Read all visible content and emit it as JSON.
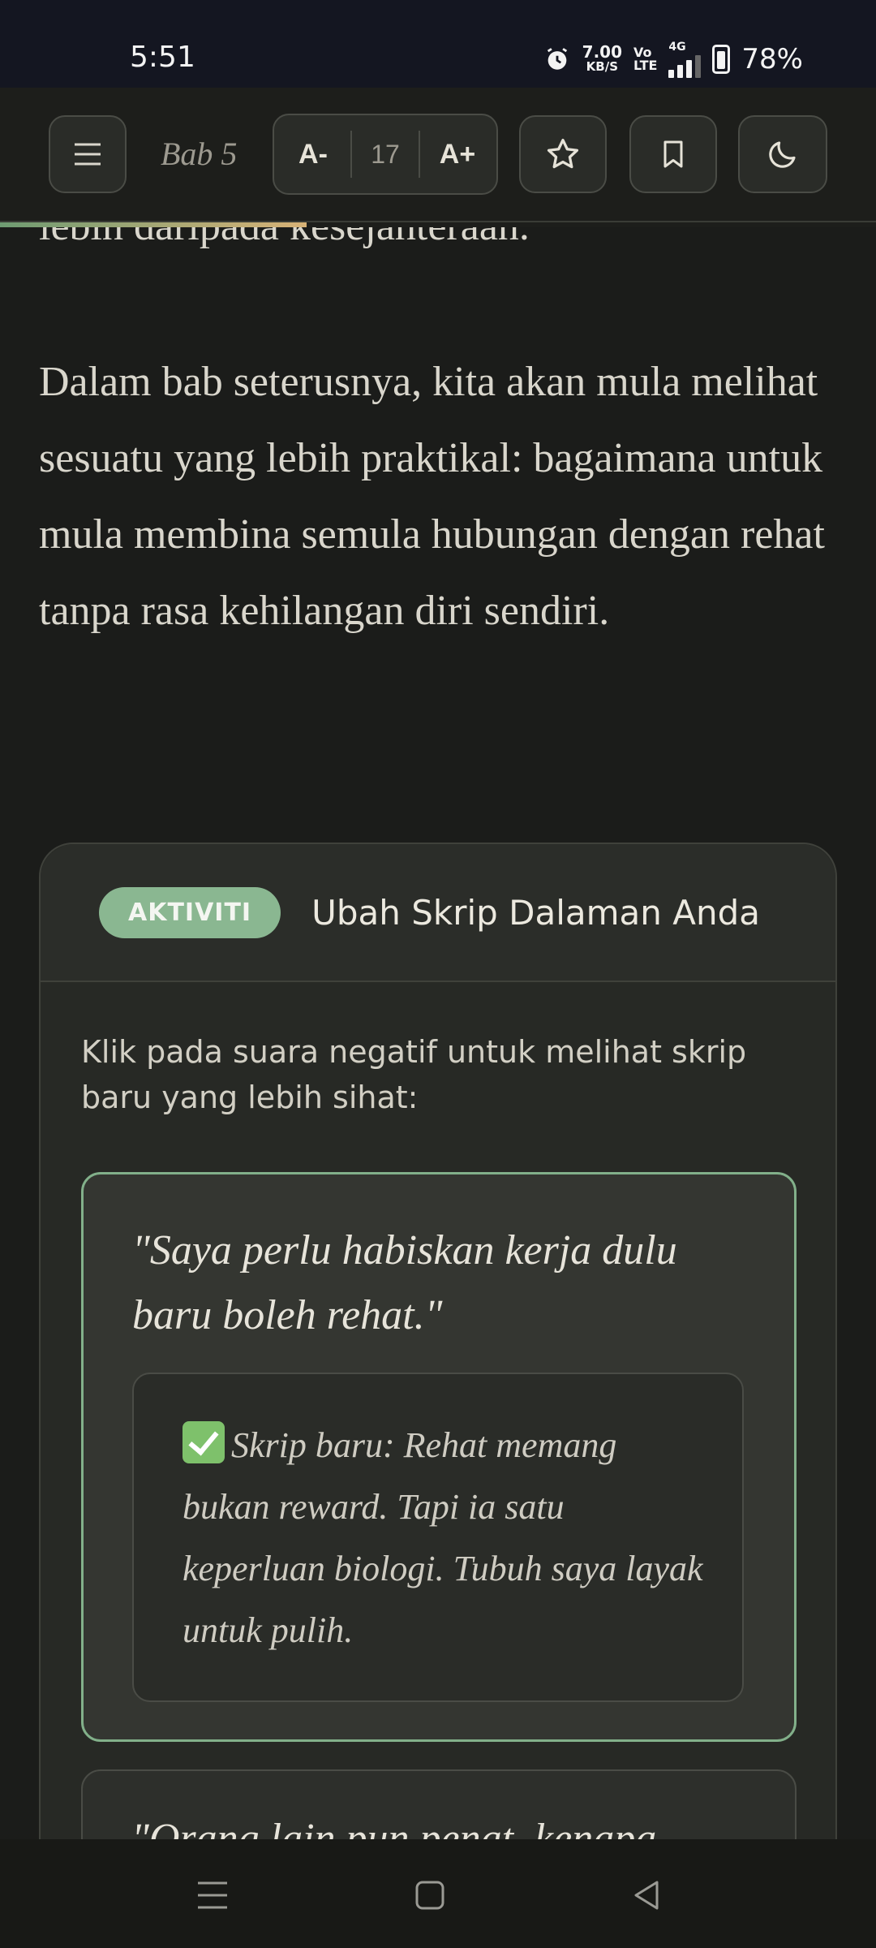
{
  "status_bar": {
    "time": "5:51",
    "net_speed_value": "7.00",
    "net_speed_unit": "KB/S",
    "volte_line1": "Vo",
    "volte_line2": "LTE",
    "network": "4G",
    "battery": "78%"
  },
  "toolbar": {
    "chapter": "Bab 5",
    "font_decrease": "A-",
    "font_size": "17",
    "font_increase": "A+"
  },
  "reading_progress": 0.35,
  "content": {
    "para_top": "lebih daripada kesejahteraan.",
    "para_main": "Dalam bab seterusnya, kita akan mula melihat sesuatu yang lebih praktikal: bagaimana untuk mula membina semula hubungan dengan rehat tanpa rasa kehilangan diri sendiri."
  },
  "activity": {
    "badge": "AKTIVITI",
    "title": "Ubah Skrip Dalaman Anda",
    "instruction": "Klik pada suara negatif untuk melihat skrip baru yang lebih sihat:",
    "scripts": [
      {
        "quote": "\"Saya perlu habiskan kerja dulu baru boleh rehat.\"",
        "answer": "Skrip baru: Rehat memang bukan reward. Tapi ia satu keperluan biologi. Tubuh saya layak untuk pulih."
      },
      {
        "quote": "\"Orang lain pun penat, kenapa"
      }
    ]
  },
  "colors": {
    "accent": "#8ab791",
    "background": "#1b1c1a",
    "status_bar": "#141621"
  }
}
